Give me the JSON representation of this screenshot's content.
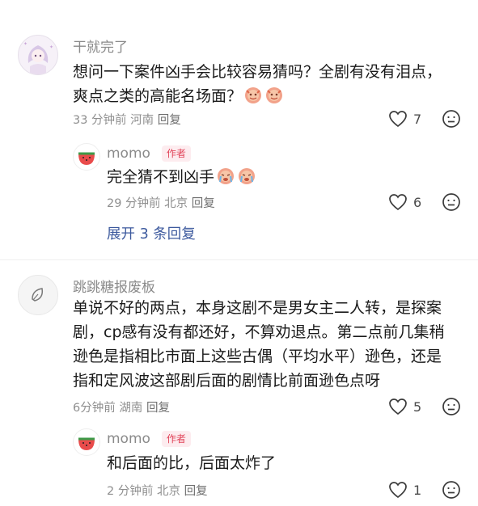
{
  "top_cut_text": "••• •• •••",
  "comments": [
    {
      "username": "干就完了",
      "text_line1": "想问一下案件凶手会比较容易猜吗？全剧有没有泪点，",
      "text_line2": "爽点之类的高能名场面？",
      "meta": "33 分钟前  河南",
      "reply_label": "回复",
      "likes": "7",
      "emoji1": "face-emoji",
      "emoji2": "face-emoji",
      "reply": {
        "username": "momo",
        "tag": "作者",
        "text": "完全猜不到凶手",
        "meta": "29 分钟前  北京",
        "reply_label": "回复",
        "likes": "6"
      },
      "expand_label": "展开 3 条回复"
    },
    {
      "username": "跳跳糖报废板",
      "text_line1": "单说不好的两点，本身这剧不是男女主二人转，是探案",
      "text_line2": "剧，cp感有没有都还好，不算劝退点。第二点前几集稍",
      "text_line3": "逊色是指相比市面上这些古偶（平均水平）逊色，还是",
      "text_line4": "指和定风波这部剧后面的剧情比前面逊色点呀",
      "meta": "6分钟前  湖南",
      "reply_label": "回复",
      "likes": "5",
      "reply": {
        "username": "momo",
        "tag": "作者",
        "text": "和后面的比，后面太炸了",
        "meta": "2 分钟前  北京",
        "reply_label": "回复",
        "likes": "1"
      }
    }
  ],
  "colors": {
    "author_tag": "#e1455a",
    "expand_link": "#3d5a9e"
  }
}
